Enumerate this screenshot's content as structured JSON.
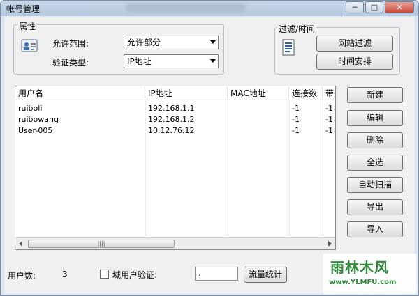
{
  "window": {
    "title": "帐号管理",
    "caption_buttons": {
      "minimize": "─",
      "maximize": "□",
      "close": "✕"
    }
  },
  "properties": {
    "group_title": "属性",
    "icon": "user-card-icon",
    "allow_range_label": "允许范围:",
    "allow_range_value": "允许部分",
    "auth_type_label": "验证类型:",
    "auth_type_value": "IP地址"
  },
  "filter_time": {
    "group_title": "过滤/时间",
    "icon": "document-icon",
    "website_filter": "网站过滤",
    "time_schedule": "时间安排"
  },
  "table": {
    "columns": [
      "用户名",
      "IP地址",
      "MAC地址",
      "连接数",
      "带"
    ],
    "rows": [
      [
        "ruiboli",
        "192.168.1.1",
        "",
        "-1",
        "-1"
      ],
      [
        "ruibowang",
        "192.168.1.2",
        "",
        "-1",
        "-1"
      ],
      [
        "User-005",
        "10.12.76.12",
        "",
        "-1",
        "-1"
      ]
    ]
  },
  "actions": {
    "new": "新建",
    "edit": "编辑",
    "delete": "删除",
    "select_all": "全选",
    "auto_scan": "自动扫描",
    "export": "导出",
    "import": "导入"
  },
  "footer": {
    "user_count_label": "用户数:",
    "user_count_value": "3",
    "domain_auth_label": "域用户验证:",
    "domain_field_value": ".",
    "traffic_stats": "流量统计"
  },
  "watermark": {
    "logo": "雨林木风",
    "url": "www.YLMFU.com"
  },
  "colors": {
    "window_frame": "#dfe8f3",
    "panel": "#f0f0f0",
    "watermark": "#2f8a3a"
  }
}
